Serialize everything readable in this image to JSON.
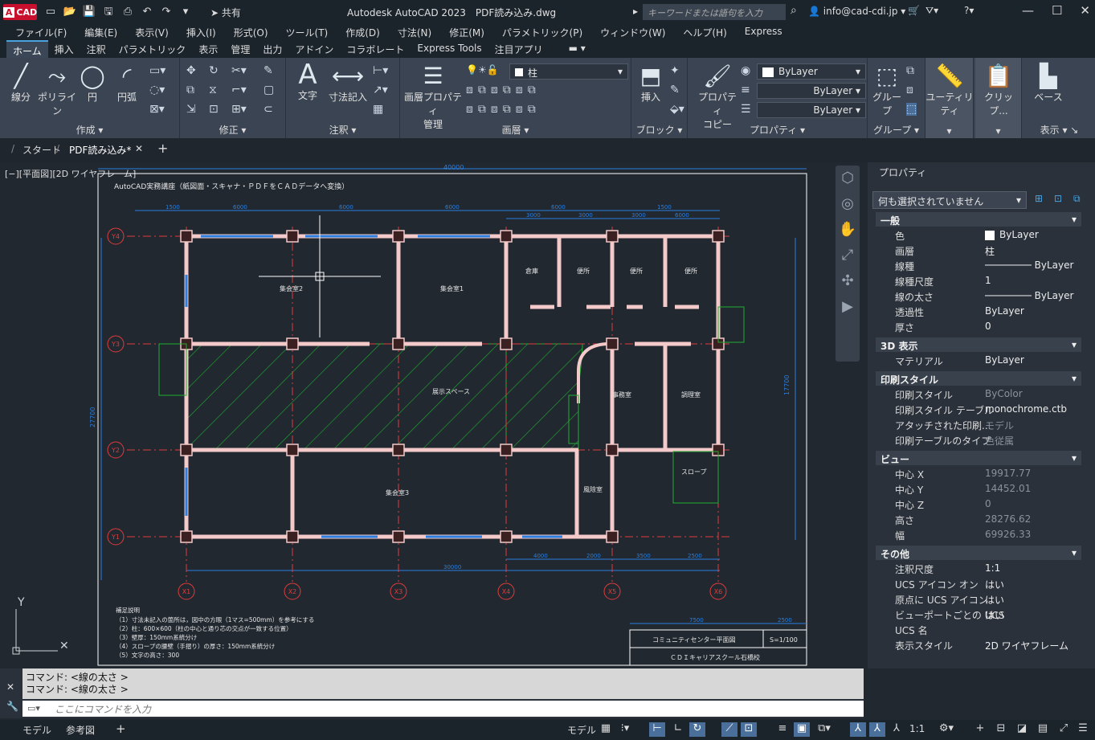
{
  "app": {
    "logo": "CAD",
    "title": "Autodesk AutoCAD 2023　PDF読み込み.dwg",
    "share": "共有",
    "search_placeholder": "キーワードまたは語句を入力",
    "user": "info@cad-cdi.jp"
  },
  "menu": [
    "ファイル(F)",
    "編集(E)",
    "表示(V)",
    "挿入(I)",
    "形式(O)",
    "ツール(T)",
    "作成(D)",
    "寸法(N)",
    "修正(M)",
    "パラメトリック(P)",
    "ウィンドウ(W)",
    "ヘルプ(H)",
    "Express"
  ],
  "ribbon_tabs": [
    "ホーム",
    "挿入",
    "注釈",
    "パラメトリック",
    "表示",
    "管理",
    "出力",
    "アドイン",
    "コラボレート",
    "Express Tools",
    "注目アプリ"
  ],
  "ribbon": {
    "create": {
      "title": "作成",
      "line": "線分",
      "polyline": "ポリライン",
      "circle": "円",
      "arc": "円弧"
    },
    "modify": {
      "title": "修正"
    },
    "annotate": {
      "title": "注釈",
      "text": "文字",
      "dim": "寸法記入"
    },
    "layers": {
      "title": "画層",
      "layer_props_1": "画層プロパティ",
      "layer_props_2": "管理",
      "current_layer": "柱"
    },
    "block": {
      "title": "ブロック",
      "insert": "挿入"
    },
    "properties": {
      "title": "プロパティ",
      "copy_1": "プロパティ",
      "copy_2": "コピー",
      "color": "ByLayer",
      "linetype": "ByLayer",
      "lineweight": "ByLayer"
    },
    "groups": {
      "title": "グループ",
      "group": "グループ"
    },
    "utilities": {
      "label": "ユーティリティ"
    },
    "clipboard": {
      "label": "クリップ..."
    },
    "view": {
      "title": "表示",
      "base": "ベース"
    }
  },
  "doc_tabs": {
    "start": "スタート",
    "current": "PDF読み込み*"
  },
  "viewport_label": "[−][平面図][2D ワイヤフレーム]",
  "drawing": {
    "heading": "AutoCAD実務講座（紙図面・スキャナ・ＰＤＦをＣＡＤデータへ変換）",
    "top_total": "40000",
    "bottom_total": "30000",
    "left_total": "27700",
    "right_total": "17700",
    "rooms": [
      "集会室2",
      "集会室1",
      "倉庫",
      "便所",
      "便所",
      "便所",
      "展示スペース",
      "事務室",
      "調理室",
      "集会室3",
      "風除室",
      "スロープ"
    ],
    "grid_x": [
      "X1",
      "X2",
      "X3",
      "X4",
      "X5",
      "X6"
    ],
    "grid_y": [
      "Y4",
      "Y3",
      "Y2",
      "Y1"
    ],
    "top_dims": [
      "1500",
      "6000",
      "6000",
      "6000",
      "6000",
      "1500"
    ],
    "top_dims2": [
      "3000",
      "3000",
      "3000",
      "6000"
    ],
    "bottom_dims": [
      "4000",
      "2000",
      "3500",
      "2500"
    ],
    "notes_title": "補足説明",
    "notes": [
      "（1）寸法未記入の箇所は，図中の方眼（1マス=500mm）を参考にする",
      "（2）柱：600×600（柱の中心と通り芯の交点が一致する位置）",
      "（3）壁厚：150mm系統分け",
      "（4）スロープの腰壁（手摺り）の厚さ：150mm系統分け",
      "（5）文字の高さ：300"
    ],
    "title_block": {
      "name": "コミュニティセンター平面図",
      "scale": "S=1/100",
      "school": "ＣＤＩキャリアスクール石橋校",
      "dim_a": "7500",
      "dim_b": "2500"
    }
  },
  "properties_palette": {
    "title": "プロパティ",
    "selection": "何も選択されていません",
    "sections": [
      {
        "name": "一般",
        "rows": [
          [
            "色",
            "ByLayer"
          ],
          [
            "画層",
            "柱"
          ],
          [
            "線種",
            "ByLayer"
          ],
          [
            "線種尺度",
            "1"
          ],
          [
            "線の太さ",
            "ByLayer"
          ],
          [
            "透過性",
            "ByLayer"
          ],
          [
            "厚さ",
            "0"
          ]
        ]
      },
      {
        "name": "3D 表示",
        "rows": [
          [
            "マテリアル",
            "ByLayer"
          ]
        ]
      },
      {
        "name": "印刷スタイル",
        "rows": [
          [
            "印刷スタイル",
            "ByColor"
          ],
          [
            "印刷スタイル テーブル",
            "monochrome.ctb"
          ],
          [
            "アタッチされた印刷...",
            "モデル"
          ],
          [
            "印刷テーブルのタイプ",
            "色従属"
          ]
        ]
      },
      {
        "name": "ビュー",
        "rows": [
          [
            "中心 X",
            "19917.77"
          ],
          [
            "中心 Y",
            "14452.01"
          ],
          [
            "中心 Z",
            "0"
          ],
          [
            "高さ",
            "28276.62"
          ],
          [
            "幅",
            "69926.33"
          ]
        ]
      },
      {
        "name": "その他",
        "rows": [
          [
            "注釈尺度",
            "1:1"
          ],
          [
            "UCS アイコン オン",
            "はい"
          ],
          [
            "原点に UCS アイコン",
            "はい"
          ],
          [
            "ビューポートごとの UCS",
            "はい"
          ],
          [
            "UCS 名",
            ""
          ],
          [
            "表示スタイル",
            "2D ワイヤフレーム"
          ]
        ]
      }
    ]
  },
  "command": {
    "history": [
      "コマンド:  <線の太さ >",
      "コマンド:  <線の太さ >"
    ],
    "placeholder": "ここにコマンドを入力"
  },
  "status": {
    "tab_model": "モデル",
    "tab_layout": "参考図",
    "model": "モデル",
    "scale": "1:1"
  },
  "colors": {
    "bg": "#212830",
    "panel": "#3b4452",
    "grid_red": "#e03c3c",
    "dim_blue": "#2a7fe0",
    "hatch_green": "#1fae2e"
  }
}
